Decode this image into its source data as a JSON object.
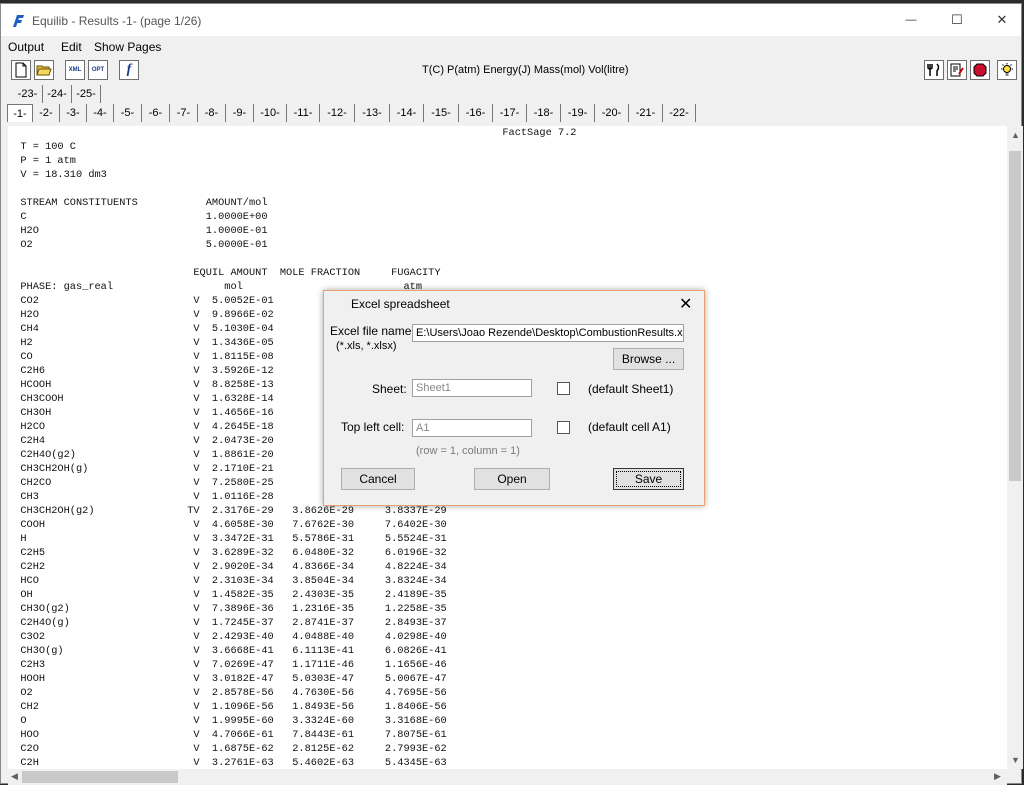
{
  "window": {
    "title": "Equilib - Results  -1-  (page 1/26)",
    "minimize_glyph": "—",
    "maximize_glyph": "☐",
    "close_glyph": "✕"
  },
  "menu": [
    "Output",
    "Edit",
    "Show Pages"
  ],
  "toolbar": {
    "units": "T(C)  P(atm)  Energy(J)  Mass(mol)  Vol(litre)",
    "buttons": [
      {
        "name": "new-document-icon"
      },
      {
        "name": "open-folder-icon"
      },
      {
        "name": "xml-icon",
        "label": "XML"
      },
      {
        "name": "opt-icon",
        "label": "OPT"
      },
      {
        "name": "function-icon",
        "label": "f"
      }
    ],
    "right_buttons": [
      {
        "name": "fork-knife-icon"
      },
      {
        "name": "edit-document-icon"
      },
      {
        "name": "stop-icon"
      },
      {
        "name": "lightbulb-icon"
      }
    ]
  },
  "page_tabs_row1": [
    "-23-",
    "-24-",
    "-25-"
  ],
  "page_tabs_row2": [
    "-1-",
    "-2-",
    "-3-",
    "-4-",
    "-5-",
    "-6-",
    "-7-",
    "-8-",
    "-9-",
    "-10-",
    "-11-",
    "-12-",
    "-13-",
    "-14-",
    "-15-",
    "-16-",
    "-17-",
    "-18-",
    "-19-",
    "-20-",
    "-21-",
    "-22-"
  ],
  "report_lines": [
    "                                                                                FactSage 7.2",
    "  T = 100 C",
    "  P = 1 atm",
    "  V = 18.310 dm3",
    "",
    "  STREAM CONSTITUENTS           AMOUNT/mol",
    "  C                             1.0000E+00",
    "  H2O                           1.0000E-01",
    "  O2                            5.0000E-01",
    "",
    "                              EQUIL AMOUNT  MOLE FRACTION     FUGACITY",
    "  PHASE: gas_real                  mol                          atm",
    "  CO2                         V  5.0052E-01",
    "  H2O                         V  9.8966E-02",
    "  CH4                         V  5.1030E-04",
    "  H2                          V  1.3436E-05",
    "  CO                          V  1.8115E-08",
    "  C2H6                        V  3.5926E-12",
    "  HCOOH                       V  8.8258E-13",
    "  CH3COOH                     V  1.6328E-14",
    "  CH3OH                       V  1.4656E-16",
    "  H2CO                        V  4.2645E-18",
    "  C2H4                        V  2.0473E-20",
    "  C2H4O(g2)                   V  1.8861E-20",
    "  CH3CH2OH(g)                 V  2.1710E-21",
    "  CH2CO                       V  7.2580E-25",
    "  CH3                         V  1.0116E-28",
    "  CH3CH2OH(g2)               TV  2.3176E-29   3.8626E-29     3.8337E-29",
    "  COOH                        V  4.6058E-30   7.6762E-30     7.6402E-30",
    "  H                           V  3.3472E-31   5.5786E-31     5.5524E-31",
    "  C2H5                        V  3.6289E-32   6.0480E-32     6.0196E-32",
    "  C2H2                        V  2.9020E-34   4.8366E-34     4.8224E-34",
    "  HCO                         V  2.3103E-34   3.8504E-34     3.8324E-34",
    "  OH                          V  1.4582E-35   2.4303E-35     2.4189E-35",
    "  CH3O(g2)                    V  7.3896E-36   1.2316E-35     1.2258E-35",
    "  C2H4O(g)                    V  1.7245E-37   2.8741E-37     2.8493E-37",
    "  C3O2                        V  2.4293E-40   4.0488E-40     4.0298E-40",
    "  CH3O(g)                     V  3.6668E-41   6.1113E-41     6.0826E-41",
    "  C2H3                        V  7.0269E-47   1.1711E-46     1.1656E-46",
    "  HOOH                        V  3.0182E-47   5.0303E-47     5.0067E-47",
    "  O2                          V  2.8578E-56   4.7630E-56     4.7695E-56",
    "  CH2                         V  1.1096E-56   1.8493E-56     1.8406E-56",
    "  O                           V  1.9995E-60   3.3324E-60     3.3168E-60",
    "  HOO                         V  4.7066E-61   7.8443E-61     7.8075E-61",
    "  C2O                         V  1.6875E-62   2.8125E-62     2.7993E-62",
    "  C2H                         V  3.2761E-63   5.4602E-63     5.4345E-63"
  ],
  "dialog": {
    "title": "Excel spreadsheet",
    "close_glyph": "✕",
    "file_label": "Excel file name:",
    "file_ext_hint": "(*.xls, *.xlsx)",
    "file_value": "E:\\Users\\Joao Rezende\\Desktop\\CombustionResults.xl",
    "browse_label": "Browse ...",
    "sheet_label": "Sheet:",
    "sheet_value": "Sheet1",
    "sheet_default_label": "(default Sheet1)",
    "cell_label": "Top left cell:",
    "cell_value": "A1",
    "cell_default_label": "(default cell A1)",
    "row_col_hint": "(row = 1,  column = 1)",
    "cancel_label": "Cancel",
    "open_label": "Open",
    "save_label": "Save"
  },
  "colors": {
    "accent_border": "#e8a070",
    "app_icon": "#1f5fbf"
  }
}
